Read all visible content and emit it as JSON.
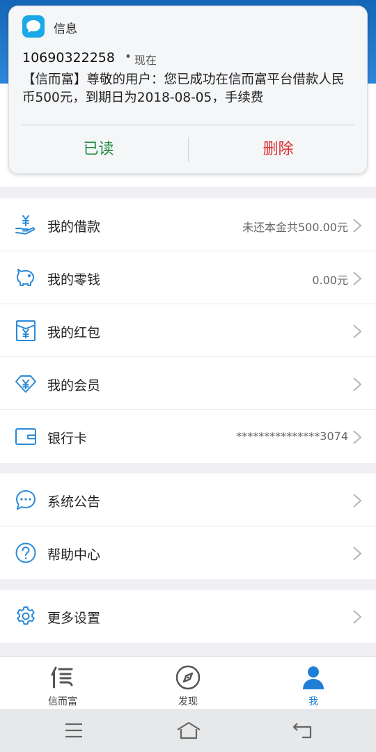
{
  "notification": {
    "app_name": "信息",
    "sender": "10690322258",
    "separator": "•",
    "time": "现在",
    "body": "【信而富】尊敬的用户：您已成功在信而富平台借款人民币500元，到期日为2018-08-05，手续费",
    "read_label": "已读",
    "delete_label": "删除"
  },
  "account_items": [
    {
      "label": "我的借款",
      "value": "未还本金共500.00元",
      "icon": "yen-hand-icon"
    },
    {
      "label": "我的零钱",
      "value": "0.00元",
      "icon": "piggy-bank-icon"
    },
    {
      "label": "我的红包",
      "value": "",
      "icon": "red-envelope-icon"
    },
    {
      "label": "我的会员",
      "value": "",
      "icon": "diamond-yen-icon"
    },
    {
      "label": "银行卡",
      "value": "***************3074",
      "icon": "bank-card-icon"
    }
  ],
  "info_items": [
    {
      "label": "系统公告",
      "icon": "chat-bubble-icon"
    },
    {
      "label": "帮助中心",
      "icon": "question-circle-icon"
    }
  ],
  "settings_items": [
    {
      "label": "更多设置",
      "icon": "gear-icon"
    }
  ],
  "tabs": [
    {
      "label": "信而富",
      "icon": "xin-logo-icon",
      "active": false
    },
    {
      "label": "发现",
      "icon": "compass-icon",
      "active": false
    },
    {
      "label": "我",
      "icon": "person-icon",
      "active": true
    }
  ],
  "colors": {
    "accent": "#2a8ad8",
    "read_button": "#1e8a3c",
    "delete_button": "#e02b2b",
    "header": "#1566b8",
    "active_tab": "#1f7fd6"
  }
}
